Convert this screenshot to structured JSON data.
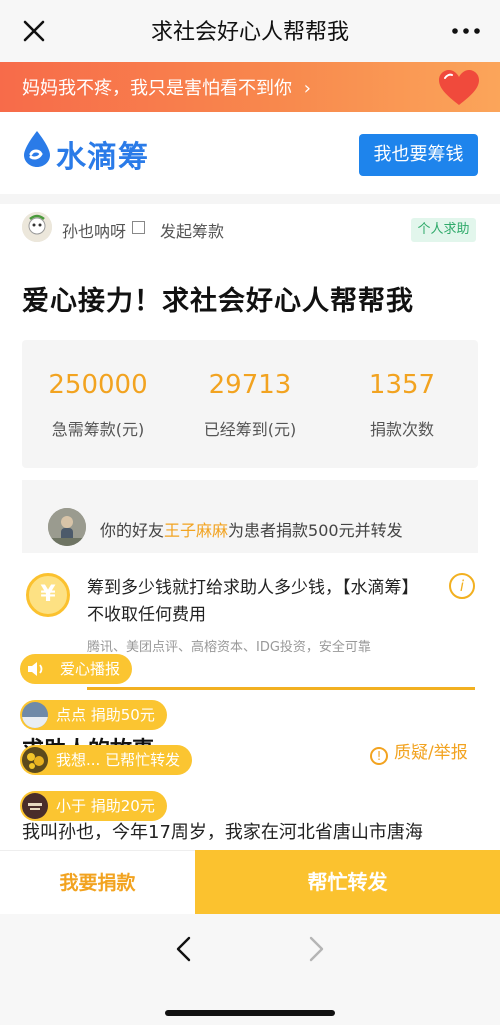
{
  "topnav": {
    "title": "求社会好心人帮帮我"
  },
  "banner": {
    "text": "妈妈我不疼，我只是害怕看不到你",
    "chevron": "›"
  },
  "header": {
    "logo_text": "水滴筹",
    "raise_button": "我也要筹钱"
  },
  "initiator": {
    "name": "孙也呐呀",
    "action": "发起筹款",
    "tag": "个人求助"
  },
  "campaign": {
    "title": "爱心接力！求社会好心人帮帮我"
  },
  "stats": [
    {
      "value": "250000",
      "label": "急需筹款(元)"
    },
    {
      "value": "29713",
      "label": "已经筹到(元)"
    },
    {
      "value": "1357",
      "label": "捐款次数"
    }
  ],
  "friend": {
    "prefix": "你的好友",
    "name": "王子麻麻",
    "suffix": "为患者捐款500元并转发"
  },
  "notice": {
    "coin_symbol": "¥",
    "text": "筹到多少钱就打给求助人多少钱，【水滴筹】不收取任何费用",
    "info_symbol": "i",
    "partners": "腾讯、美团点评、高榕资本、IDG投资，安全可靠"
  },
  "pills": {
    "broadcast": "爱心播报",
    "p1": "点点  捐助50元",
    "p2": "我想...  已帮忙转发",
    "p3": "小于  捐助20元"
  },
  "story": {
    "title": "求助人的故事",
    "report": "质疑/举报",
    "report_icon": "!",
    "text": "我叫孙也，今年17周岁，我家在河北省唐山市唐海"
  },
  "actions": {
    "donate": "我要捐款",
    "share": "帮忙转发"
  },
  "colors": {
    "accent": "#f2a320",
    "brand_blue": "#1e84ec",
    "banner": "#f76b4a",
    "share_bg": "#fbc22f"
  },
  "icons": [
    "close-icon",
    "more-icon",
    "heart-icon",
    "water-drop-logo-icon",
    "yuan-coin-icon",
    "info-icon",
    "warning-icon",
    "speaker-icon",
    "back-icon",
    "forward-icon"
  ]
}
